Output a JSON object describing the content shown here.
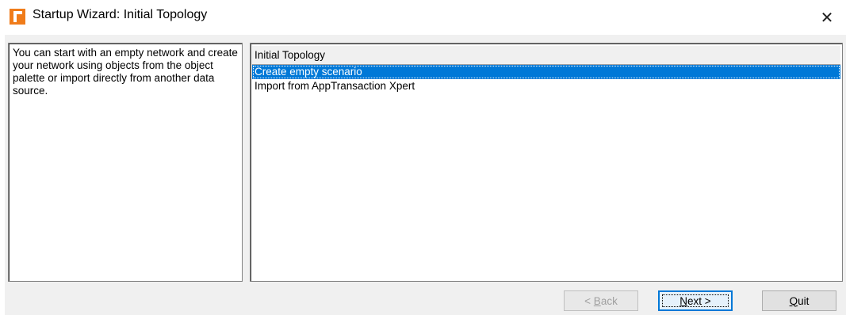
{
  "window": {
    "title": "Startup Wizard: Initial Topology",
    "app_icon": "opnet-logo-icon",
    "close_icon": "close-icon",
    "close_glyph": "✕"
  },
  "description": {
    "text": "You can start with an empty network and create your network using objects from the object palette or import directly from another data source."
  },
  "topology_list": {
    "header": "Initial Topology",
    "items": [
      {
        "label": "Create empty scenario",
        "selected": true
      },
      {
        "label": "Import from AppTransaction Xpert",
        "selected": false
      }
    ]
  },
  "buttons": {
    "back": {
      "prefix": "< ",
      "mnemonic": "B",
      "rest": "ack",
      "enabled": false
    },
    "next": {
      "mnemonic": "N",
      "rest": "ext >",
      "enabled": true,
      "default": true
    },
    "quit": {
      "mnemonic": "Q",
      "rest": "uit",
      "enabled": true
    }
  },
  "colors": {
    "selection": "#0078d7",
    "app_icon": "#f07c1a",
    "dialog_background": "#f0f0f0"
  }
}
